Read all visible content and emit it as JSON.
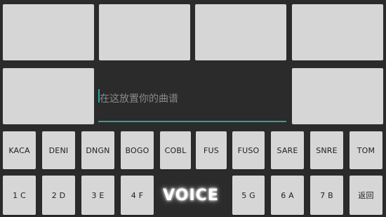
{
  "score_input": {
    "placeholder": "在这放置你的曲谱",
    "value": ""
  },
  "row_sounds": [
    "KACA",
    "DENI",
    "DNGN",
    "BOGO",
    "COBL",
    "FUS",
    "FUSO",
    "SARE",
    "SNRE",
    "TOM"
  ],
  "row_notes_left": [
    "1 C",
    "2 D",
    "3 E",
    "4 F"
  ],
  "voice_label": "VOICE",
  "row_notes_right": [
    "5 G",
    "6 A",
    "7 B"
  ],
  "back_label": "返回",
  "colors": {
    "accent": "#26a69a",
    "background": "#2b2b2b",
    "button": "#d6d6d6"
  }
}
